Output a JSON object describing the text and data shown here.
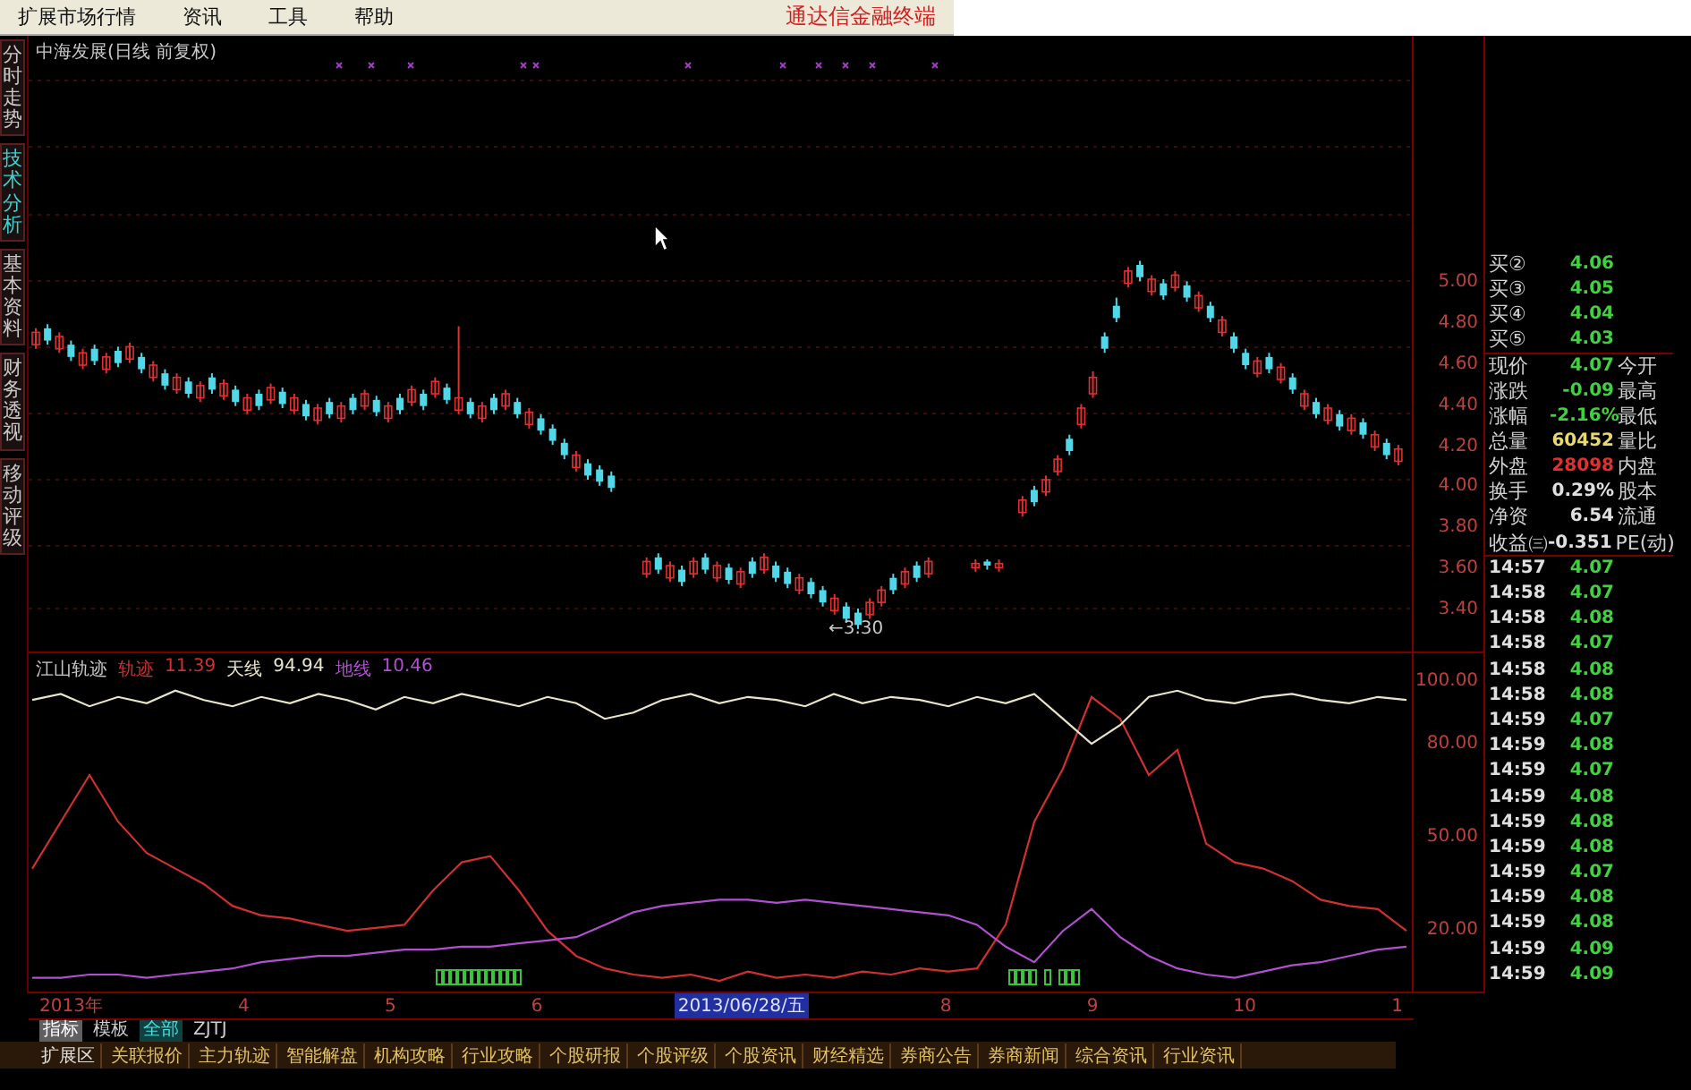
{
  "menu": {
    "items": [
      "扩展市场行情",
      "资讯",
      "工具",
      "帮助"
    ],
    "brand": "通达信金融终端"
  },
  "side_tabs": [
    {
      "label": "分时走势",
      "selected": false
    },
    {
      "label": "技术分析",
      "selected": true
    },
    {
      "label": "基本资料",
      "selected": false
    },
    {
      "label": "财务透视",
      "selected": false
    },
    {
      "label": "移动评级",
      "selected": false
    }
  ],
  "price_chart": {
    "title": "中海发展(日线 前复权)",
    "low_label": "←3.30",
    "chart_data": {
      "type": "candlestick",
      "ylim": [
        3.19,
        6.2
      ],
      "yticks": [
        {
          "value": 5.0,
          "label": "5.00"
        },
        {
          "value": 4.8,
          "label": "4.80"
        },
        {
          "value": 4.6,
          "label": "4.60"
        },
        {
          "value": 4.4,
          "label": "4.40"
        },
        {
          "value": 4.2,
          "label": "4.20"
        },
        {
          "value": 4.0,
          "label": "4.00"
        },
        {
          "value": 3.8,
          "label": "3.80"
        },
        {
          "value": 3.6,
          "label": "3.60"
        },
        {
          "value": 3.4,
          "label": "3.40"
        }
      ],
      "ohlc": [
        [
          4.69,
          4.77,
          4.67,
          4.75
        ],
        [
          4.77,
          4.79,
          4.69,
          4.71
        ],
        [
          4.67,
          4.75,
          4.65,
          4.73
        ],
        [
          4.69,
          4.71,
          4.61,
          4.63
        ],
        [
          4.59,
          4.67,
          4.57,
          4.65
        ],
        [
          4.67,
          4.69,
          4.59,
          4.61
        ],
        [
          4.57,
          4.65,
          4.55,
          4.63
        ],
        [
          4.66,
          4.68,
          4.58,
          4.6
        ],
        [
          4.62,
          4.7,
          4.6,
          4.68
        ],
        [
          4.63,
          4.65,
          4.55,
          4.57
        ],
        [
          4.53,
          4.61,
          4.51,
          4.59
        ],
        [
          4.55,
          4.57,
          4.47,
          4.49
        ],
        [
          4.47,
          4.55,
          4.45,
          4.53
        ],
        [
          4.51,
          4.53,
          4.43,
          4.45
        ],
        [
          4.43,
          4.51,
          4.41,
          4.49
        ],
        [
          4.53,
          4.55,
          4.45,
          4.47
        ],
        [
          4.44,
          4.52,
          4.42,
          4.5
        ],
        [
          4.47,
          4.49,
          4.39,
          4.41
        ],
        [
          4.37,
          4.45,
          4.35,
          4.43
        ],
        [
          4.45,
          4.47,
          4.37,
          4.39
        ],
        [
          4.42,
          4.5,
          4.4,
          4.48
        ],
        [
          4.46,
          4.48,
          4.38,
          4.4
        ],
        [
          4.37,
          4.45,
          4.35,
          4.43
        ],
        [
          4.4,
          4.42,
          4.32,
          4.34
        ],
        [
          4.32,
          4.4,
          4.3,
          4.38
        ],
        [
          4.41,
          4.43,
          4.33,
          4.35
        ],
        [
          4.33,
          4.41,
          4.31,
          4.39
        ],
        [
          4.43,
          4.45,
          4.35,
          4.37
        ],
        [
          4.39,
          4.47,
          4.37,
          4.45
        ],
        [
          4.42,
          4.44,
          4.34,
          4.36
        ],
        [
          4.33,
          4.41,
          4.31,
          4.39
        ],
        [
          4.43,
          4.45,
          4.35,
          4.37
        ],
        [
          4.41,
          4.49,
          4.39,
          4.47
        ],
        [
          4.45,
          4.47,
          4.37,
          4.39
        ],
        [
          4.45,
          4.53,
          4.43,
          4.51
        ],
        [
          4.48,
          4.5,
          4.4,
          4.42
        ],
        [
          4.37,
          4.78,
          4.35,
          4.43
        ],
        [
          4.41,
          4.43,
          4.33,
          4.35
        ],
        [
          4.33,
          4.41,
          4.31,
          4.39
        ],
        [
          4.43,
          4.45,
          4.35,
          4.37
        ],
        [
          4.39,
          4.47,
          4.37,
          4.45
        ],
        [
          4.41,
          4.43,
          4.33,
          4.35
        ],
        [
          4.3,
          4.38,
          4.28,
          4.36
        ],
        [
          4.33,
          4.35,
          4.25,
          4.27
        ],
        [
          4.28,
          4.3,
          4.2,
          4.22
        ],
        [
          4.21,
          4.23,
          4.13,
          4.15
        ],
        [
          4.09,
          4.17,
          4.07,
          4.15
        ],
        [
          4.11,
          4.13,
          4.03,
          4.05
        ],
        [
          4.08,
          4.1,
          4.0,
          4.02
        ],
        [
          4.05,
          4.07,
          3.97,
          3.99
        ],
        null,
        null,
        [
          3.57,
          3.65,
          3.55,
          3.63
        ],
        [
          3.65,
          3.67,
          3.57,
          3.59
        ],
        [
          3.55,
          3.63,
          3.53,
          3.61
        ],
        [
          3.59,
          3.61,
          3.51,
          3.53
        ],
        [
          3.57,
          3.65,
          3.55,
          3.63
        ],
        [
          3.65,
          3.67,
          3.57,
          3.59
        ],
        [
          3.55,
          3.63,
          3.53,
          3.61
        ],
        [
          3.6,
          3.62,
          3.52,
          3.54
        ],
        [
          3.52,
          3.6,
          3.5,
          3.58
        ],
        [
          3.63,
          3.65,
          3.55,
          3.57
        ],
        [
          3.59,
          3.67,
          3.57,
          3.65
        ],
        [
          3.61,
          3.63,
          3.53,
          3.55
        ],
        [
          3.58,
          3.6,
          3.5,
          3.52
        ],
        [
          3.49,
          3.57,
          3.47,
          3.55
        ],
        [
          3.53,
          3.55,
          3.45,
          3.47
        ],
        [
          3.49,
          3.51,
          3.41,
          3.43
        ],
        [
          3.39,
          3.47,
          3.37,
          3.45
        ],
        [
          3.41,
          3.43,
          3.33,
          3.35
        ],
        [
          3.38,
          3.4,
          3.3,
          3.32
        ],
        [
          3.37,
          3.45,
          3.35,
          3.43
        ],
        [
          3.43,
          3.51,
          3.41,
          3.49
        ],
        [
          3.55,
          3.57,
          3.47,
          3.49
        ],
        [
          3.52,
          3.6,
          3.5,
          3.58
        ],
        [
          3.61,
          3.63,
          3.53,
          3.55
        ],
        [
          3.57,
          3.65,
          3.55,
          3.63
        ],
        null,
        null,
        null,
        [
          3.6,
          3.64,
          3.58,
          3.62
        ],
        [
          3.63,
          3.64,
          3.59,
          3.61
        ],
        [
          3.6,
          3.64,
          3.58,
          3.62
        ],
        null,
        [
          3.87,
          3.95,
          3.85,
          3.93
        ],
        [
          3.98,
          4.0,
          3.9,
          3.92
        ],
        [
          3.97,
          4.05,
          3.95,
          4.03
        ],
        [
          4.07,
          4.15,
          4.05,
          4.13
        ],
        [
          4.23,
          4.25,
          4.15,
          4.17
        ],
        [
          4.3,
          4.4,
          4.28,
          4.38
        ],
        [
          4.45,
          4.56,
          4.43,
          4.53
        ],
        [
          4.73,
          4.75,
          4.65,
          4.67
        ],
        [
          4.88,
          4.92,
          4.8,
          4.82
        ],
        [
          4.99,
          5.07,
          4.97,
          5.05
        ],
        [
          5.08,
          5.1,
          5.0,
          5.02
        ],
        [
          4.95,
          5.03,
          4.93,
          5.01
        ],
        [
          4.99,
          5.01,
          4.91,
          4.93
        ],
        [
          4.97,
          5.05,
          4.95,
          5.03
        ],
        [
          4.98,
          5.0,
          4.9,
          4.92
        ],
        [
          4.87,
          4.95,
          4.85,
          4.93
        ],
        [
          4.88,
          4.9,
          4.8,
          4.82
        ],
        [
          4.75,
          4.83,
          4.73,
          4.81
        ],
        [
          4.73,
          4.75,
          4.65,
          4.67
        ],
        [
          4.65,
          4.67,
          4.57,
          4.59
        ],
        [
          4.55,
          4.63,
          4.53,
          4.61
        ],
        [
          4.63,
          4.65,
          4.55,
          4.57
        ],
        [
          4.52,
          4.6,
          4.5,
          4.58
        ],
        [
          4.53,
          4.55,
          4.45,
          4.47
        ],
        [
          4.39,
          4.47,
          4.37,
          4.45
        ],
        [
          4.41,
          4.43,
          4.33,
          4.35
        ],
        [
          4.32,
          4.4,
          4.3,
          4.38
        ],
        [
          4.35,
          4.37,
          4.27,
          4.29
        ],
        [
          4.27,
          4.35,
          4.25,
          4.33
        ],
        [
          4.31,
          4.33,
          4.23,
          4.25
        ],
        [
          4.19,
          4.27,
          4.17,
          4.25
        ],
        [
          4.21,
          4.23,
          4.13,
          4.15
        ],
        [
          4.12,
          4.2,
          4.1,
          4.18
        ]
      ]
    }
  },
  "indicator": {
    "name": "江山轨迹",
    "legend_values": [
      "11.39",
      "94.94",
      "10.46"
    ],
    "chart_data": {
      "type": "line",
      "ylim": [
        0,
        109
      ],
      "yticks": [
        {
          "value": 100,
          "label": "100.00"
        },
        {
          "value": 80,
          "label": "80.00"
        },
        {
          "value": 50,
          "label": "50.00"
        },
        {
          "value": 20,
          "label": "20.00"
        }
      ],
      "series": [
        {
          "name": "轨迹",
          "color": "#d03030",
          "values": [
            40,
            55,
            70,
            55,
            45,
            40,
            35,
            28,
            25,
            24,
            22,
            20,
            21,
            22,
            33,
            42,
            44,
            33,
            20,
            12,
            8,
            6,
            5,
            6,
            4,
            7,
            5,
            6,
            5,
            7,
            6,
            8,
            7,
            8,
            22,
            55,
            72,
            95,
            88,
            70,
            78,
            48,
            42,
            40,
            36,
            30,
            28,
            27,
            20
          ]
        },
        {
          "name": "天线",
          "color": "#e8e4c8",
          "values": [
            94,
            96,
            92,
            95,
            93,
            97,
            94,
            92,
            95,
            93,
            96,
            94,
            91,
            95,
            93,
            96,
            94,
            92,
            95,
            93,
            88,
            90,
            94,
            96,
            93,
            95,
            94,
            92,
            96,
            93,
            95,
            94,
            92,
            95,
            93,
            96,
            88,
            80,
            86,
            95,
            97,
            94,
            93,
            95,
            96,
            94,
            93,
            95,
            94
          ]
        },
        {
          "name": "地线",
          "color": "#b050d0",
          "values": [
            5,
            5,
            6,
            6,
            5,
            6,
            7,
            8,
            10,
            11,
            12,
            12,
            13,
            14,
            14,
            15,
            15,
            16,
            17,
            18,
            22,
            26,
            28,
            29,
            30,
            30,
            29,
            30,
            29,
            28,
            27,
            26,
            25,
            22,
            15,
            10,
            20,
            27,
            18,
            12,
            8,
            6,
            5,
            7,
            9,
            10,
            12,
            14,
            15
          ]
        }
      ]
    }
  },
  "x_axis": [
    {
      "label": "2013年",
      "highlighted": false
    },
    {
      "label": "4",
      "highlighted": false
    },
    {
      "label": "5",
      "highlighted": false
    },
    {
      "label": "6",
      "highlighted": false
    },
    {
      "label": "2013/06/28/五",
      "highlighted": true
    },
    {
      "label": "8",
      "highlighted": false
    },
    {
      "label": "9",
      "highlighted": false
    },
    {
      "label": "10",
      "highlighted": false
    },
    {
      "label": "1",
      "highlighted": false
    }
  ],
  "indicator_tabs": [
    {
      "label": "指标",
      "selected": true,
      "highlighted": false
    },
    {
      "label": "模板",
      "selected": false,
      "highlighted": false
    },
    {
      "label": "全部",
      "selected": false,
      "highlighted": true
    },
    {
      "label": "ZJTJ",
      "selected": false,
      "highlighted": false
    }
  ],
  "bottom_tabs": [
    "扩展区",
    "关联报价",
    "主力轨迹",
    "智能解盘",
    "机构攻略",
    "行业攻略",
    "个股研报",
    "个股评级",
    "个股资讯",
    "财经精选",
    "券商公告",
    "券商新闻",
    "综合资讯",
    "行业资讯"
  ],
  "quote": {
    "bids": [
      {
        "label": "买②",
        "price": "4.06"
      },
      {
        "label": "买③",
        "price": "4.05"
      },
      {
        "label": "买④",
        "price": "4.04"
      },
      {
        "label": "买⑤",
        "price": "4.03"
      }
    ],
    "stats": [
      {
        "label": "现价",
        "value": "4.07",
        "color": "#40d040",
        "right_label": "今开"
      },
      {
        "label": "涨跌",
        "value": "-0.09",
        "color": "#40d040",
        "right_label": "最高"
      },
      {
        "label": "涨幅",
        "value": "-2.16%",
        "color": "#40d040",
        "right_label": "最低"
      },
      {
        "label": "总量",
        "value": "60452",
        "color": "#e8d870",
        "right_label": "量比"
      },
      {
        "label": "外盘",
        "value": "28098",
        "color": "#e03030",
        "right_label": "内盘"
      },
      {
        "label": "换手",
        "value": "0.29%",
        "color": "#e0e0e0",
        "right_label": "股本"
      },
      {
        "label": "净资",
        "value": "6.54",
        "color": "#e0e0e0",
        "right_label": "流通"
      },
      {
        "label": "收益㈢",
        "value": "-0.351",
        "color": "#e0e0e0",
        "right_label": "PE(动)"
      }
    ],
    "ticks": [
      {
        "time": "14:57",
        "price": "4.07"
      },
      {
        "time": "14:58",
        "price": "4.07"
      },
      {
        "time": "14:58",
        "price": "4.08"
      },
      {
        "time": "14:58",
        "price": "4.07"
      },
      {
        "time": "14:58",
        "price": "4.08"
      },
      {
        "time": "14:58",
        "price": "4.08"
      },
      {
        "time": "14:59",
        "price": "4.07"
      },
      {
        "time": "14:59",
        "price": "4.08"
      },
      {
        "time": "14:59",
        "price": "4.07"
      },
      {
        "time": "14:59",
        "price": "4.08"
      },
      {
        "time": "14:59",
        "price": "4.08"
      },
      {
        "time": "14:59",
        "price": "4.08"
      },
      {
        "time": "14:59",
        "price": "4.07"
      },
      {
        "time": "14:59",
        "price": "4.08"
      },
      {
        "time": "14:59",
        "price": "4.08"
      },
      {
        "time": "14:59",
        "price": "4.09"
      },
      {
        "time": "14:59",
        "price": "4.09"
      }
    ]
  }
}
